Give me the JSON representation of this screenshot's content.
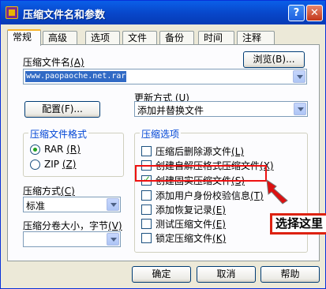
{
  "window": {
    "title": "压缩文件名和参数",
    "help_glyph": "?",
    "close_glyph": "✕"
  },
  "tabs": [
    "常规",
    "高级",
    "选项",
    "文件",
    "备份",
    "时间",
    "注释"
  ],
  "archive": {
    "label": "压缩文件名",
    "hotkey": "(A)",
    "value": "www.paopaoche.net.rar",
    "browse_label": "浏览(B)..."
  },
  "update": {
    "label": "更新方式",
    "hotkey": "(U)",
    "value": "添加并替换文件"
  },
  "profiles_label": "配置(F)...",
  "format": {
    "title": "压缩文件格式",
    "options": [
      {
        "label": "RAR",
        "hotkey": "(R)",
        "selected": true
      },
      {
        "label": "ZIP",
        "hotkey": "(Z)",
        "selected": false
      }
    ]
  },
  "method": {
    "label": "压缩方式",
    "hotkey": "(C)",
    "value": "标准"
  },
  "split": {
    "label": "压缩分卷大小，字节",
    "hotkey": "(V)",
    "value": ""
  },
  "options": {
    "title": "压缩选项",
    "items": [
      {
        "label": "压缩后删除源文件",
        "hotkey": "(L)",
        "checked": false
      },
      {
        "label": "创建自解压格式压缩文件",
        "hotkey": "(X)",
        "checked": false
      },
      {
        "label": "创建固实压缩文件",
        "hotkey": "(S)",
        "checked": true
      },
      {
        "label": "添加用户身份校验信息",
        "hotkey": "(T)",
        "checked": false
      },
      {
        "label": "添加恢复记录",
        "hotkey": "(E)",
        "checked": false
      },
      {
        "label": "测试压缩文件",
        "hotkey": "(E)",
        "checked": false
      },
      {
        "label": "锁定压缩文件",
        "hotkey": "(K)",
        "checked": false
      }
    ]
  },
  "buttons": {
    "ok": "确定",
    "cancel": "取消",
    "help": "帮助"
  },
  "annotation": {
    "text": "选择这里",
    "color": "#dd1111"
  }
}
